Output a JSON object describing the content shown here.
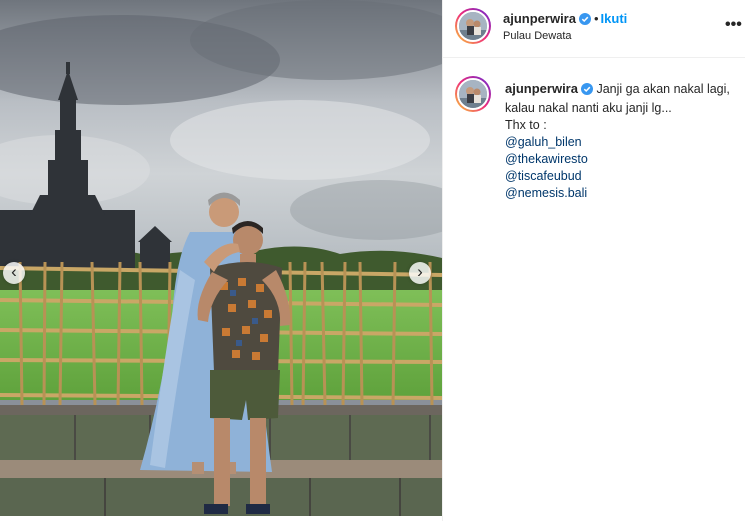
{
  "header": {
    "username": "ajunperwira",
    "separator": "•",
    "follow_label": "Ikuti",
    "location": "Pulau Dewata",
    "more_label": "•••"
  },
  "caption": {
    "username": "ajunperwira",
    "text": "Janji ga akan nakal lagi, kalau nakal nanti aku janji lg...",
    "thanks": "Thx to :",
    "mentions": [
      "@galuh_bilen",
      "@thekawiresto",
      "@tiscafeubud",
      "@nemesis.bali"
    ]
  },
  "media": {
    "prev_label": "‹",
    "next_label": "›"
  },
  "colors": {
    "accent": "#0095f6",
    "mention": "#00376b",
    "verified": "#3897f0"
  },
  "icons": [
    "verified-badge-icon",
    "more-options-icon",
    "chevron-left-icon",
    "chevron-right-icon"
  ]
}
